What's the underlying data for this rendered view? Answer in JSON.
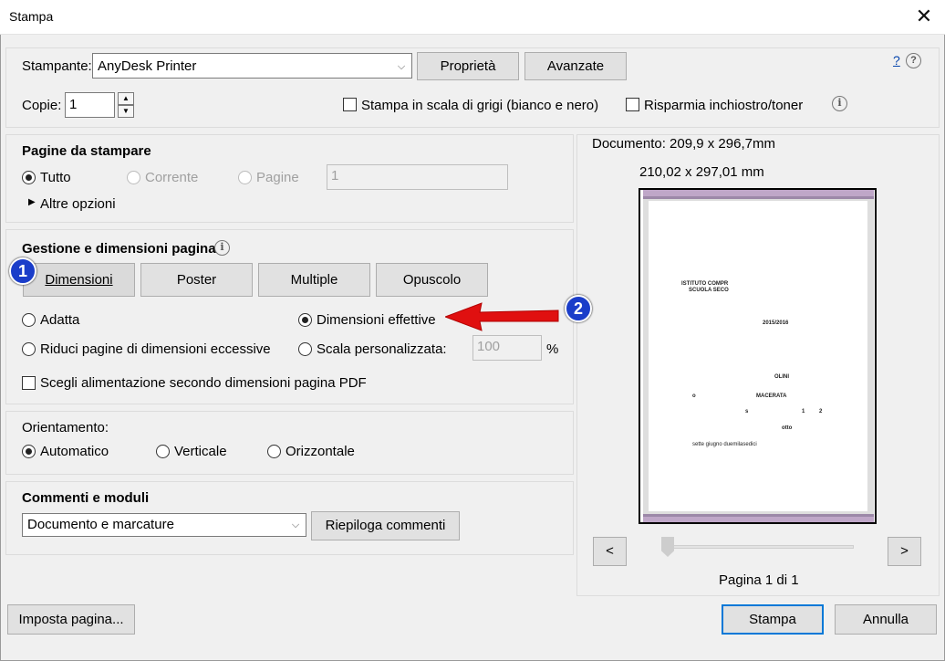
{
  "window": {
    "title": "Stampa",
    "close_glyph": "✕"
  },
  "printer": {
    "label": "Stampante:",
    "selected": "AnyDesk Printer",
    "properties_btn": "Proprietà",
    "advanced_btn": "Avanzate",
    "help_link": "?",
    "copies_label": "Copie:",
    "copies_value": "1",
    "grayscale_label": "Stampa in scala di grigi (bianco e nero)",
    "save_ink_label": "Risparmia inchiostro/toner"
  },
  "pages": {
    "title": "Pagine da stampare",
    "all": "Tutto",
    "current": "Corrente",
    "pages": "Pagine",
    "pages_value": "1",
    "more_options": "Altre opzioni"
  },
  "sizing": {
    "title": "Gestione e dimensioni pagina",
    "tabs": [
      "Dimensioni",
      "Poster",
      "Multiple",
      "Opuscolo"
    ],
    "fit": "Adatta",
    "actual_size": "Dimensioni effettive",
    "shrink": "Riduci pagine di dimensioni eccessive",
    "custom_scale": "Scala personalizzata:",
    "scale_value": "100",
    "percent": "%",
    "choose_source": "Scegli alimentazione secondo dimensioni pagina PDF"
  },
  "orientation": {
    "title": "Orientamento:",
    "auto": "Automatico",
    "portrait": "Verticale",
    "landscape": "Orizzontale"
  },
  "comments": {
    "title": "Commenti e moduli",
    "selected": "Documento e marcature",
    "summarize_btn": "Riepiloga commenti"
  },
  "preview": {
    "doc_size": "Documento: 209,9 x 296,7mm",
    "page_size": "210,02 x 297,01 mm",
    "doc_lines": [
      "ISTITUTO COMPR",
      "SCUOLA SECO",
      "2015/2016",
      "OLINI",
      "MACERATA",
      "o",
      "s",
      "1",
      "2",
      "otto",
      "sette giugno duemilasedici"
    ],
    "prev": "<",
    "next": ">",
    "page_label": "Pagina 1 di 1"
  },
  "footer": {
    "setup_btn": "Imposta pagina...",
    "print_btn": "Stampa",
    "cancel_btn": "Annulla"
  },
  "annotations": {
    "badge1": "1",
    "badge2": "2",
    "arrow_color": "#e01010",
    "badge_color": "#1a3dc9"
  }
}
